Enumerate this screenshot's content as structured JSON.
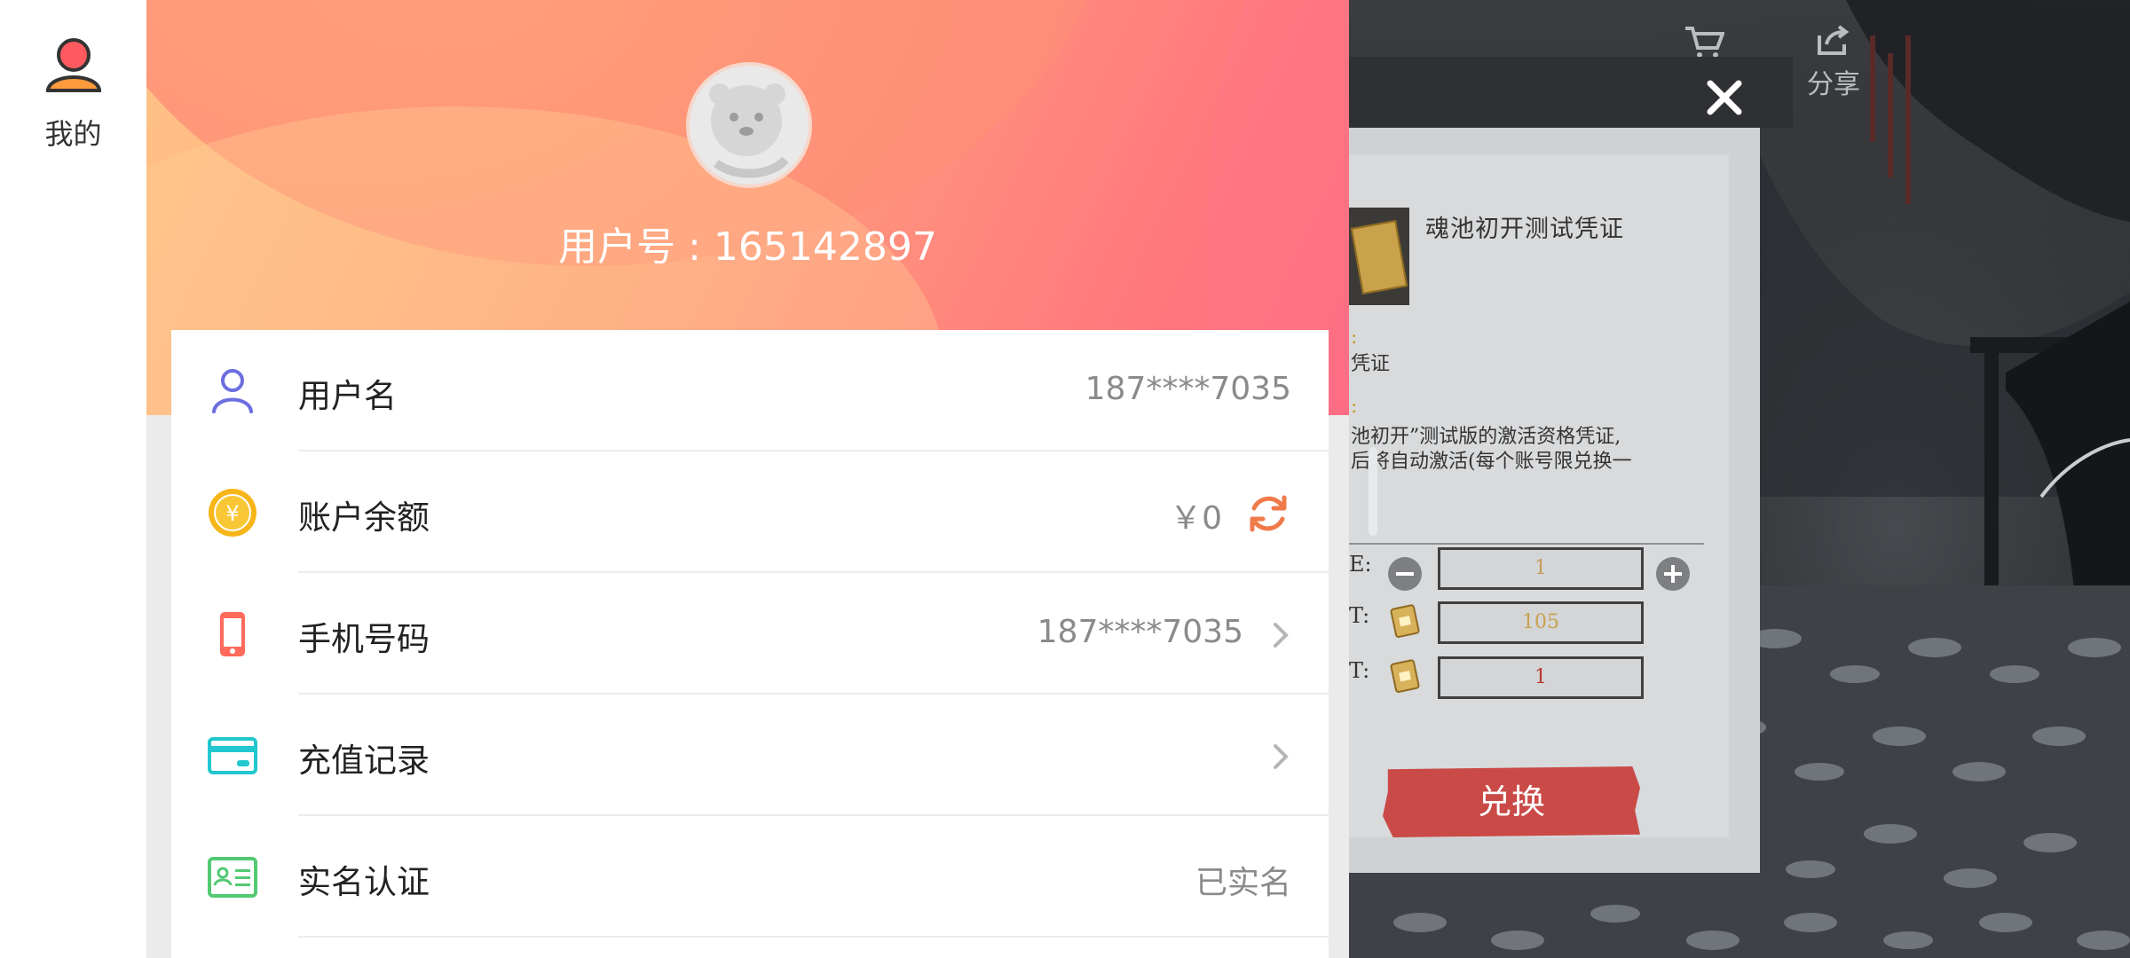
{
  "sidebar": {
    "me_label": "我的"
  },
  "header": {
    "user_id_text": "用户号 : 165142897"
  },
  "rows": [
    {
      "label": "用户名",
      "value": "187****7035",
      "icon": "user-icon"
    },
    {
      "label": "账户余额",
      "value": "￥0",
      "icon": "yen-coin-icon"
    },
    {
      "label": "手机号码",
      "value": "187****7035",
      "icon": "phone-icon"
    },
    {
      "label": "充值记录",
      "value": "",
      "icon": "card-icon"
    },
    {
      "label": "实名认证",
      "value": "已实名",
      "icon": "id-card-icon"
    }
  ],
  "game": {
    "top_buttons": [
      {
        "label": ""
      },
      {
        "label": "分享"
      }
    ],
    "dialog": {
      "item_name": "魂池初开测试凭证",
      "line_a": ":",
      "line_b": "凭证",
      "line_c": ":",
      "desc_1": "池初开”测试版的激活资格凭证,",
      "desc_2": "后将自动激活(每个账号限兑换一",
      "qty_label": "E:",
      "cost_label": "T:",
      "own_label": "T:",
      "qty_value": "1",
      "cost_value": "105",
      "own_value": "1",
      "exchange_label": "兑换"
    }
  },
  "colors": {
    "accent_orange": "#f07a4a",
    "header_start": "#ffc386",
    "header_end": "#ff6780",
    "exchange_red": "#c94a46"
  }
}
